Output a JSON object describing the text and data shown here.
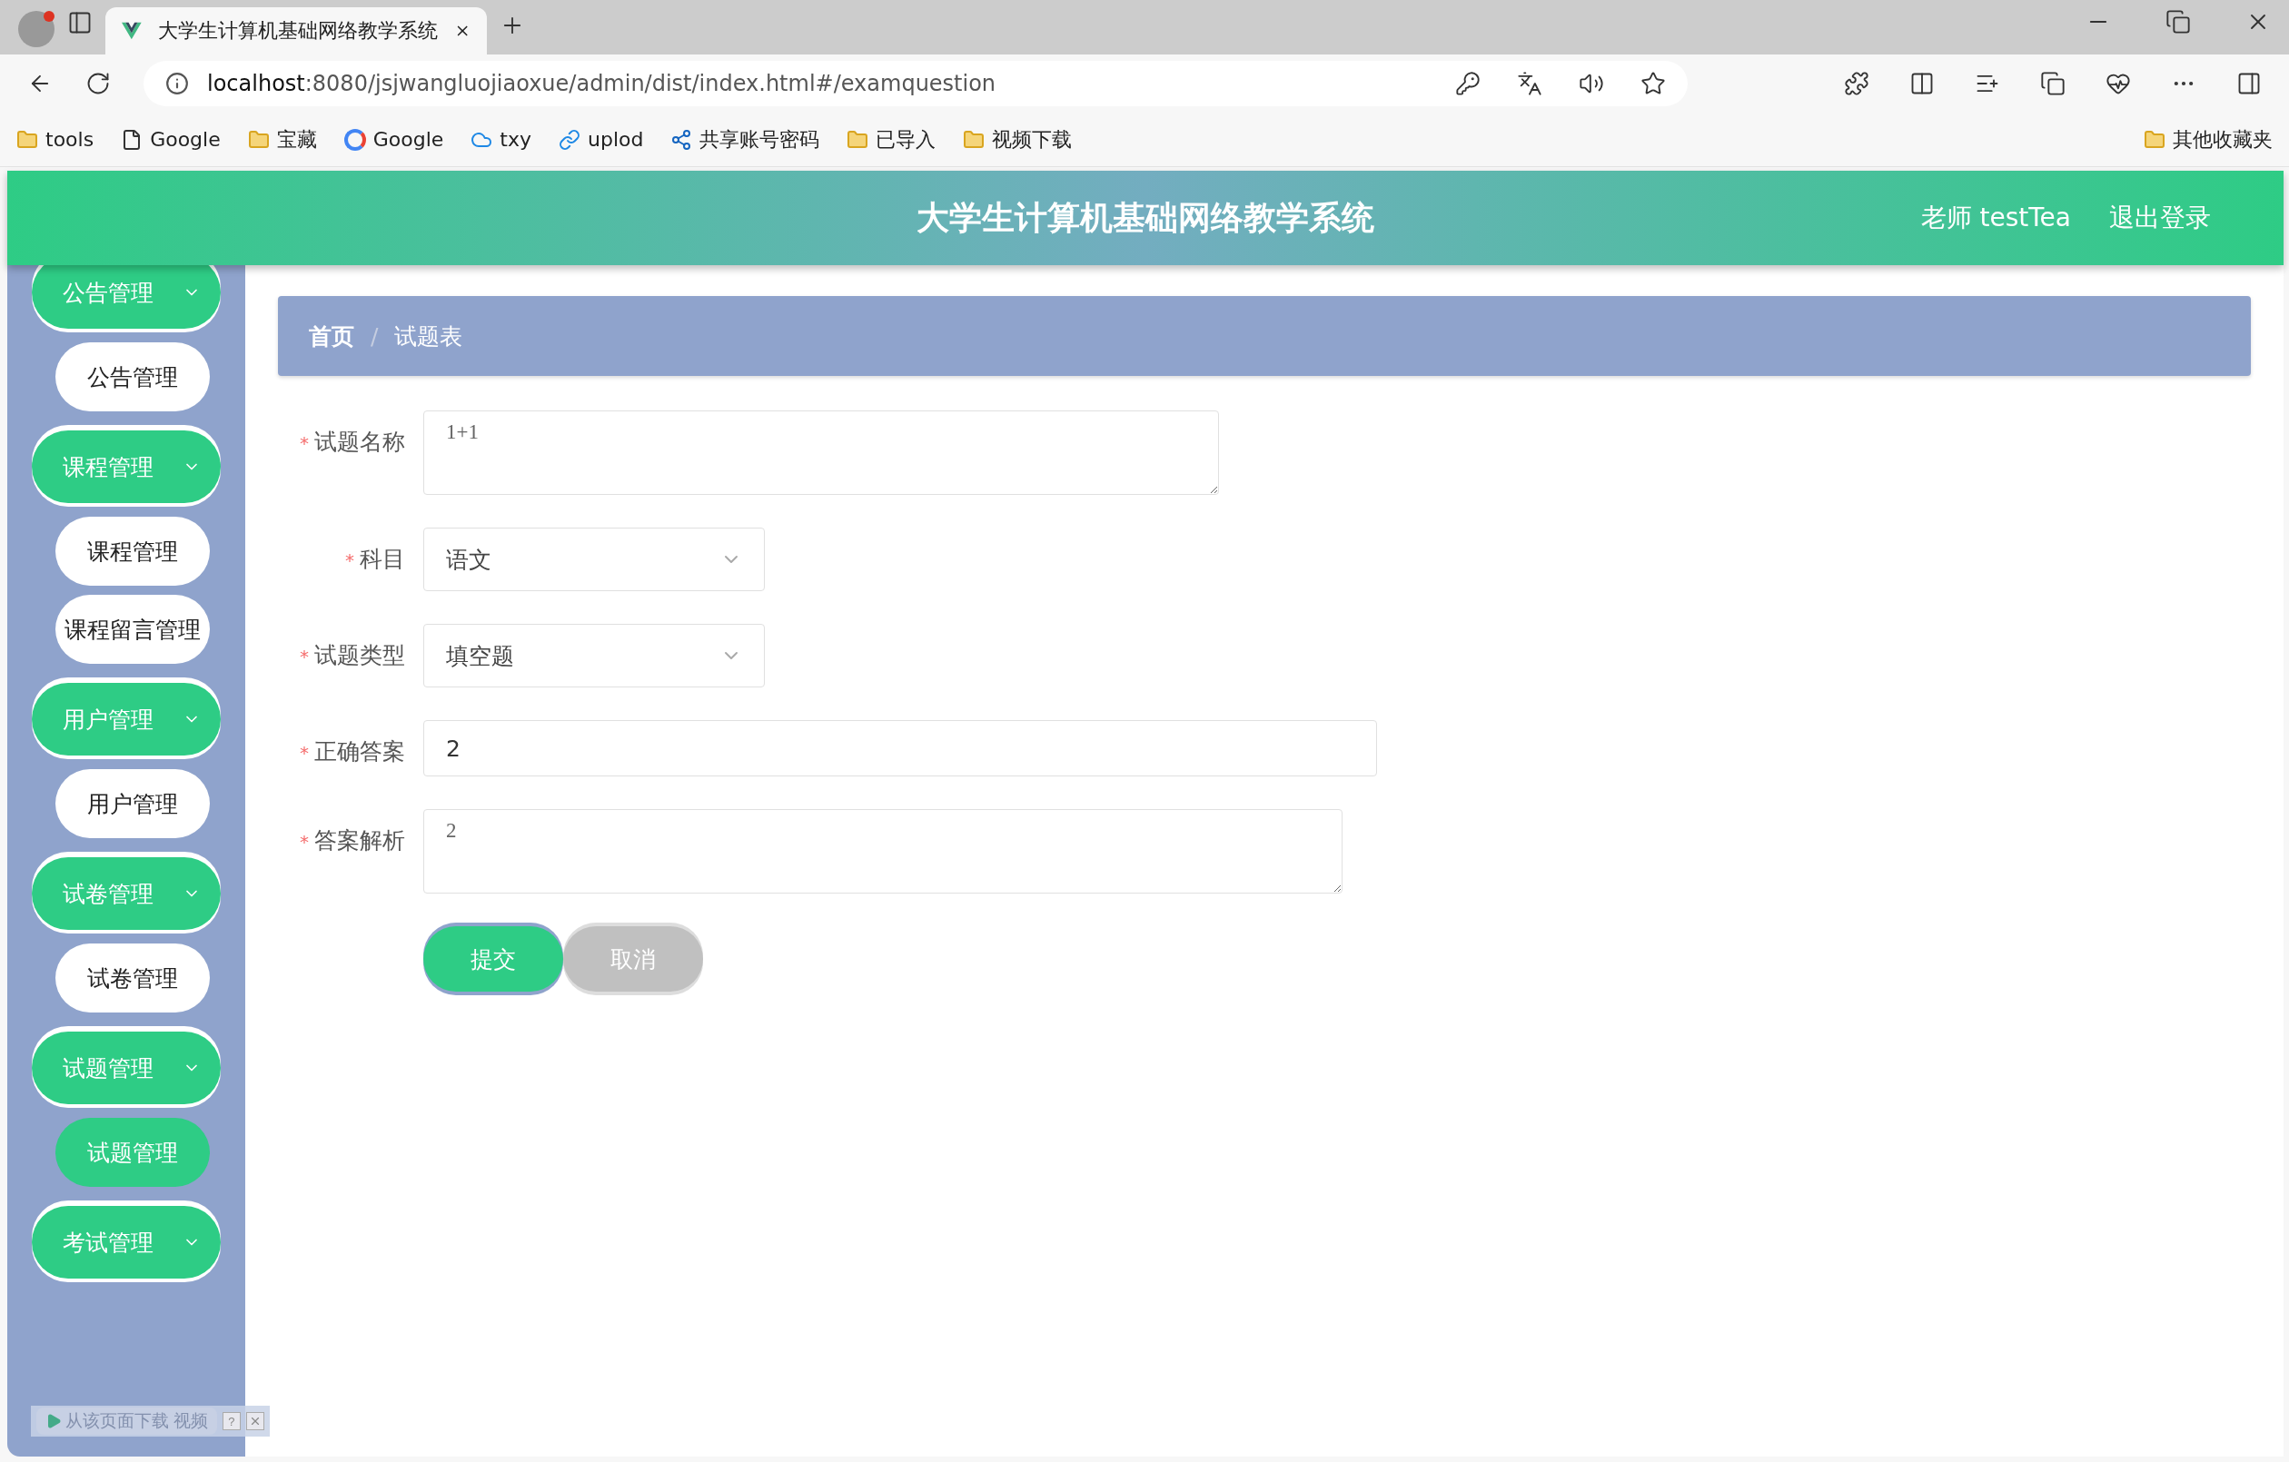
{
  "browser": {
    "tab_title": "大学生计算机基础网络教学系统",
    "url_host": "localhost",
    "url_rest": ":8080/jsjwangluojiaoxue/admin/dist/index.html#/examquestion",
    "bookmarks": [
      {
        "label": "tools",
        "kind": "folder"
      },
      {
        "label": "Google",
        "kind": "page"
      },
      {
        "label": "宝藏",
        "kind": "folder"
      },
      {
        "label": "Google",
        "kind": "google"
      },
      {
        "label": "txy",
        "kind": "cloud"
      },
      {
        "label": "uplod",
        "kind": "link"
      },
      {
        "label": "共享账号密码",
        "kind": "share"
      },
      {
        "label": "已导入",
        "kind": "folder"
      },
      {
        "label": "视频下载",
        "kind": "folder"
      }
    ],
    "other_bookmarks": "其他收藏夹"
  },
  "header": {
    "title": "大学生计算机基础网络教学系统",
    "user": "老师 testTea",
    "logout": "退出登录"
  },
  "sidebar": [
    {
      "label": "公告管理",
      "children": [
        {
          "label": "公告管理",
          "selected": false
        }
      ]
    },
    {
      "label": "课程管理",
      "children": [
        {
          "label": "课程管理",
          "selected": false
        },
        {
          "label": "课程留言管理",
          "selected": false
        }
      ]
    },
    {
      "label": "用户管理",
      "children": [
        {
          "label": "用户管理",
          "selected": false
        }
      ]
    },
    {
      "label": "试卷管理",
      "children": [
        {
          "label": "试卷管理",
          "selected": false
        }
      ]
    },
    {
      "label": "试题管理",
      "children": [
        {
          "label": "试题管理",
          "selected": true
        }
      ]
    },
    {
      "label": "考试管理"
    }
  ],
  "breadcrumb": [
    "首页",
    "试题表"
  ],
  "breadcrumb_separator": "/",
  "form": [
    {
      "label": "试题名称",
      "kind": "textarea",
      "value": "1+1",
      "required_mark": "*"
    },
    {
      "label": "科目",
      "kind": "select",
      "value": "语文",
      "required_mark": "*"
    },
    {
      "label": "试题类型",
      "kind": "select",
      "value": "填空题",
      "required_mark": "*"
    },
    {
      "label": "正确答案",
      "kind": "input",
      "value": "2",
      "required_mark": "*"
    },
    {
      "label": "答案解析",
      "kind": "textarea",
      "value": "2",
      "required_mark": "*"
    }
  ],
  "buttons": [
    {
      "label": "提交",
      "kind": "primary"
    },
    {
      "label": "取消",
      "kind": "cancel"
    }
  ],
  "download_bar": {
    "label": "从该页面下载 视频",
    "help": "?"
  }
}
